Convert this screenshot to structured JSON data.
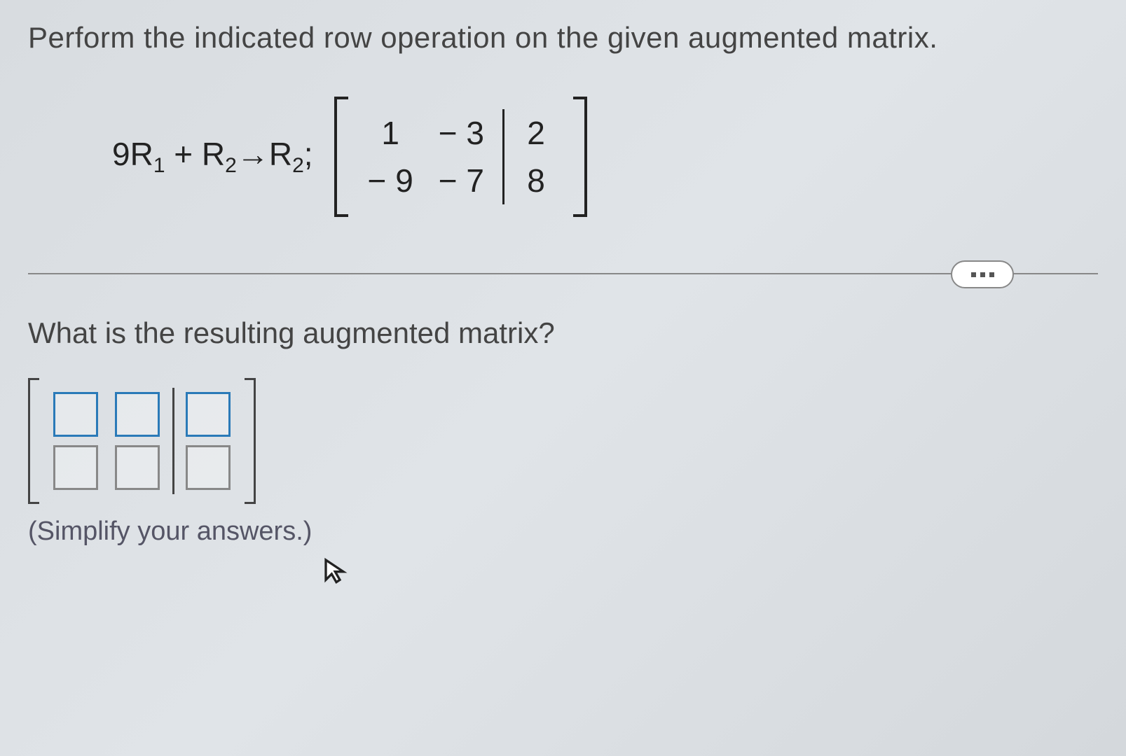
{
  "instruction": "Perform the indicated row operation on the given augmented matrix.",
  "operation": {
    "prefix": "9R",
    "sub1": "1",
    "mid": " + R",
    "sub2": "2",
    "arrow": "→R",
    "sub3": "2",
    "suffix": ";"
  },
  "matrix": {
    "r1c1": "1",
    "r1c2": "− 3",
    "r1c3": "2",
    "r2c1": "− 9",
    "r2c2": "− 7",
    "r2c3": "8"
  },
  "question": "What is the resulting augmented matrix?",
  "hint": "(Simplify your answers.)",
  "inputs": {
    "a11": "",
    "a12": "",
    "a13": "",
    "a21": "",
    "a22": "",
    "a23": ""
  }
}
